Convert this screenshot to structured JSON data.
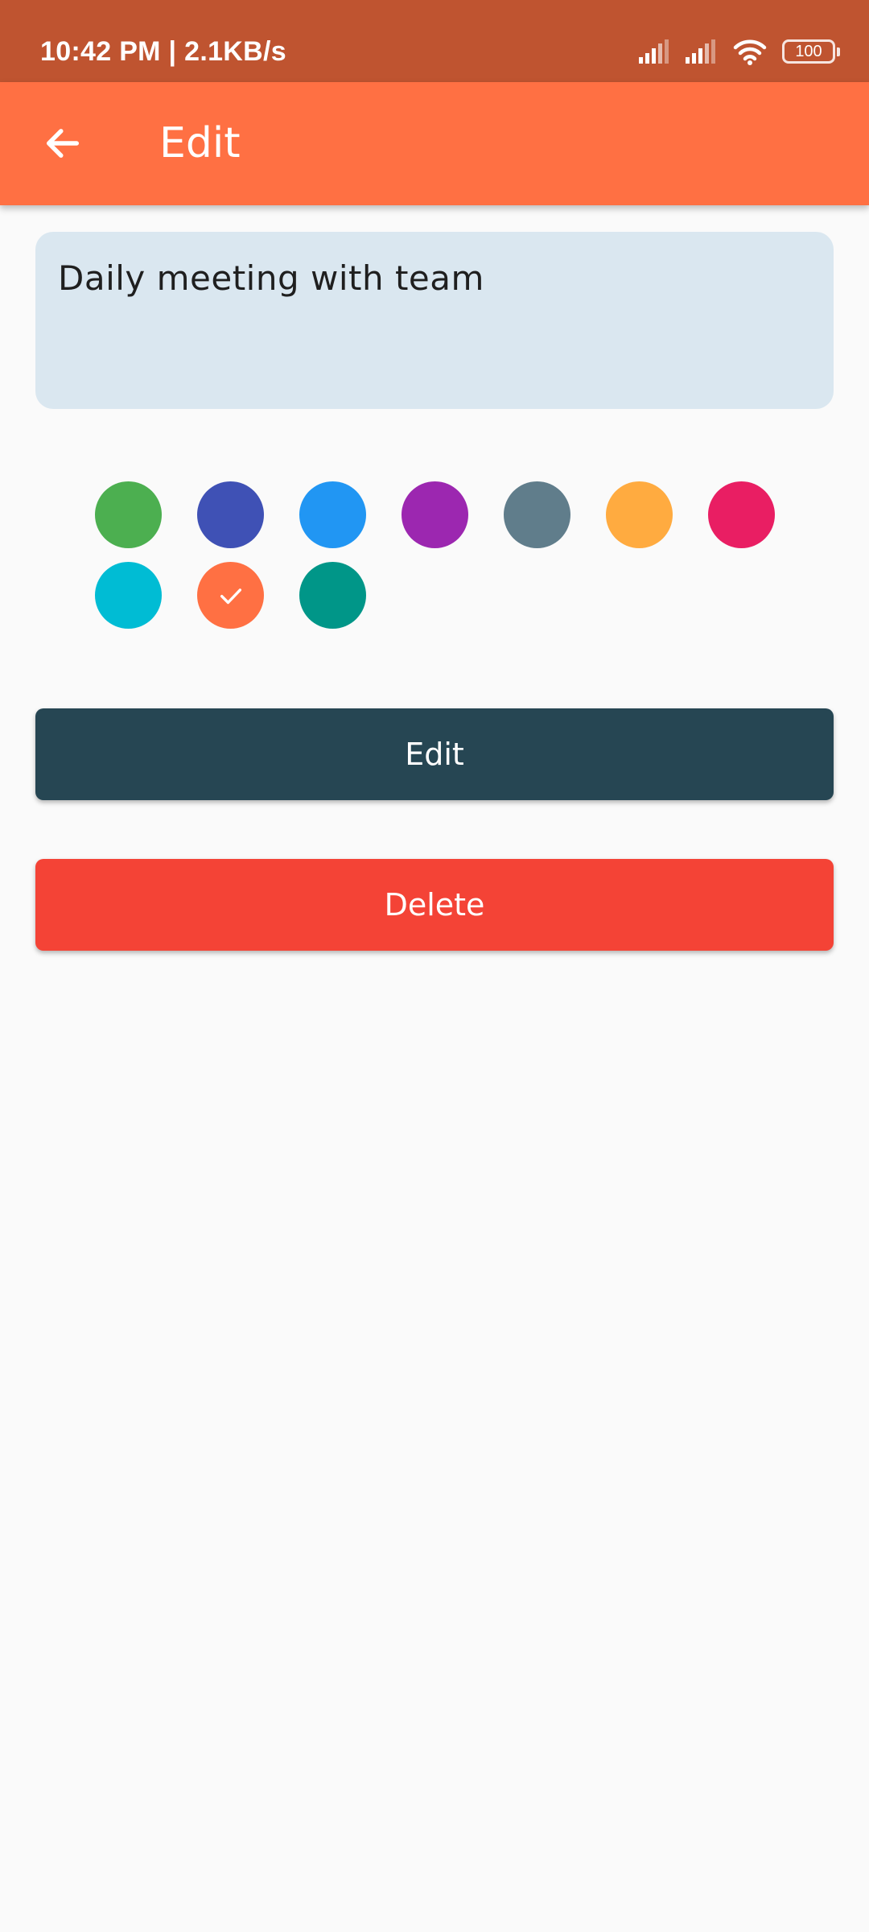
{
  "status_bar": {
    "text": "10:42 PM | 2.1KB/s",
    "battery": "100",
    "background": "#bf5430"
  },
  "app_bar": {
    "title": "Edit",
    "back_icon": "arrow-back-icon",
    "background": "#ff7043"
  },
  "note": {
    "text": "Daily meeting with team",
    "background": "#dae7f0"
  },
  "color_options": [
    {
      "name": "green",
      "color": "#4caf50",
      "selected": false
    },
    {
      "name": "indigo",
      "color": "#3f51b5",
      "selected": false
    },
    {
      "name": "blue",
      "color": "#2196f3",
      "selected": false
    },
    {
      "name": "purple",
      "color": "#9c27b0",
      "selected": false
    },
    {
      "name": "blue-grey",
      "color": "#607d8b",
      "selected": false
    },
    {
      "name": "orange",
      "color": "#ffab40",
      "selected": false
    },
    {
      "name": "pink",
      "color": "#e91e63",
      "selected": false
    },
    {
      "name": "cyan",
      "color": "#00bcd4",
      "selected": false
    },
    {
      "name": "deep-orange",
      "color": "#ff7043",
      "selected": true
    },
    {
      "name": "teal",
      "color": "#009688",
      "selected": false
    }
  ],
  "actions": {
    "edit_label": "Edit",
    "edit_color": "#264653",
    "delete_label": "Delete",
    "delete_color": "#f44336"
  }
}
